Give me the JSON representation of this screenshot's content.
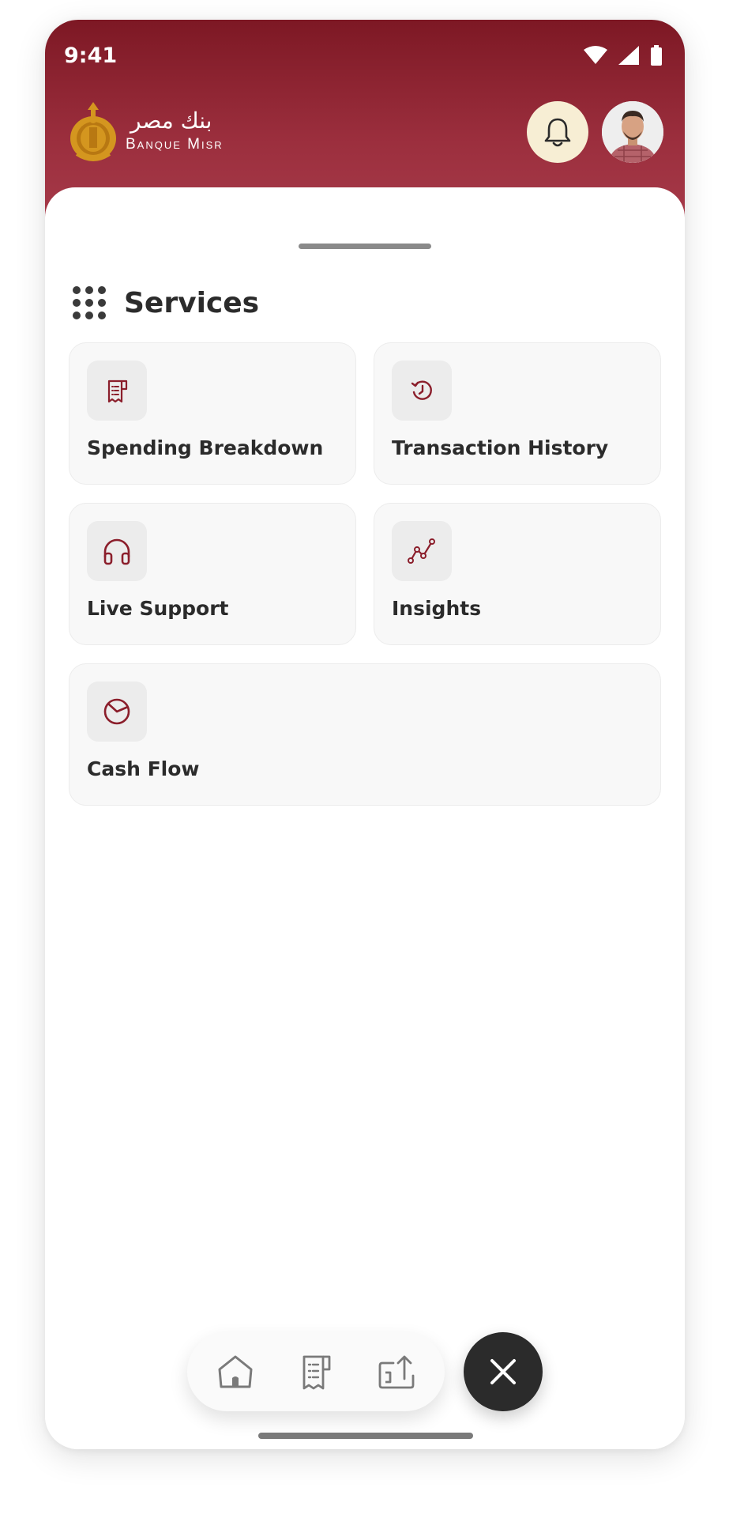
{
  "status_bar": {
    "time": "9:41"
  },
  "header": {
    "logo": {
      "arabic_text": "بنك مصر",
      "latin_text": "Banque Misr"
    },
    "notification_icon": "bell-icon",
    "profile_icon": "avatar"
  },
  "services": {
    "title": "Services",
    "title_icon": "grid-dots-icon",
    "items": [
      {
        "label": "Spending Breakdown",
        "icon": "receipt-icon"
      },
      {
        "label": "Transaction History",
        "icon": "history-icon"
      },
      {
        "label": "Live Support",
        "icon": "headphones-icon"
      },
      {
        "label": "Insights",
        "icon": "trend-line-icon"
      },
      {
        "label": "Cash Flow",
        "icon": "pie-chart-icon"
      }
    ]
  },
  "bottom_nav": {
    "items": [
      {
        "icon": "home-icon"
      },
      {
        "icon": "receipt-icon"
      },
      {
        "icon": "transfer-icon"
      }
    ],
    "close_icon": "close-icon"
  },
  "colors": {
    "brand": "#8b1e2b",
    "header_start": "#7d1824",
    "header_end": "#a63a49",
    "logo_gold": "#d4961f",
    "card_bg": "#f8f8f8",
    "icon_tile": "#ececec",
    "text_dark": "#2b2b2b",
    "fab": "#2b2b2b"
  }
}
